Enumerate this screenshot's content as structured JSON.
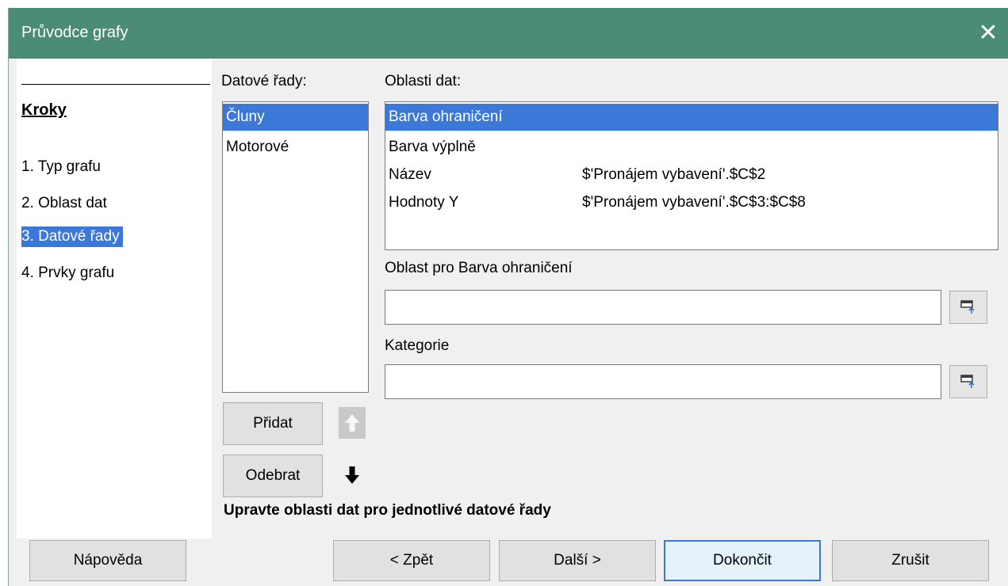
{
  "window": {
    "title": "Průvodce grafy"
  },
  "steps": {
    "heading": "Kroky",
    "items": [
      {
        "label": "1. Typ grafu"
      },
      {
        "label": "2. Oblast dat"
      },
      {
        "label": "3. Datové řady"
      },
      {
        "label": "4. Prvky grafu"
      }
    ]
  },
  "series": {
    "label": "Datové řady:",
    "items": [
      "Čluny",
      "Motorové"
    ]
  },
  "ranges": {
    "label": "Oblasti dat:",
    "rows": [
      {
        "name": "Barva ohraničení",
        "value": ""
      },
      {
        "name": "Barva výplně",
        "value": ""
      },
      {
        "name": "Název",
        "value": "$'Pronájem vybavení'.$C$2"
      },
      {
        "name": "Hodnoty Y",
        "value": "$'Pronájem vybavení'.$C$3:$C$8"
      }
    ]
  },
  "range_for": {
    "label": "Oblast pro Barva ohraničení",
    "value": ""
  },
  "categories": {
    "label": "Kategorie",
    "value": ""
  },
  "buttons": {
    "add": "Přidat",
    "remove": "Odebrat",
    "help": "Nápověda",
    "back": "< Zpět",
    "next": "Další >",
    "finish": "Dokončit",
    "cancel": "Zrušit"
  },
  "hint": "Upravte oblasti dat pro jednotlivé datové řady"
}
